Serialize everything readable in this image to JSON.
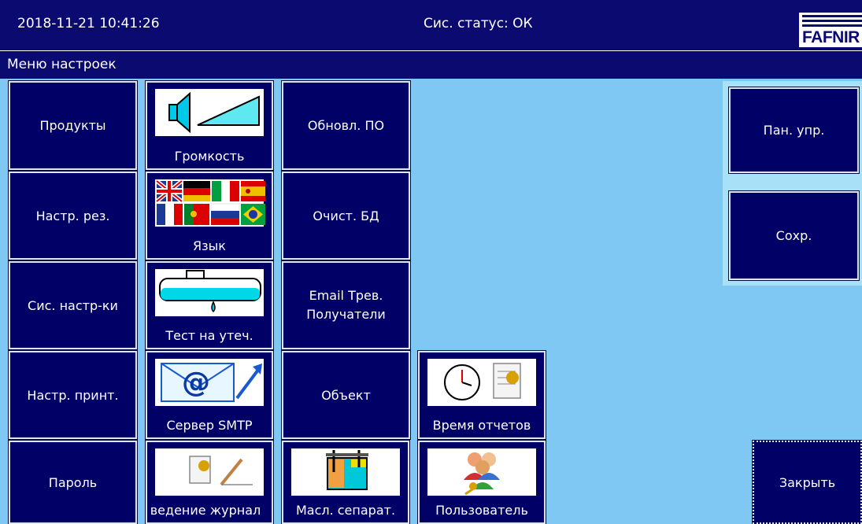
{
  "header": {
    "datetime": "2018-11-21  10:41:26",
    "status": "Сис. статус: ОК",
    "logo_text": "FAFNIR"
  },
  "menu_title": "Меню настроек",
  "buttons": {
    "products": "Продукты",
    "volume": "Громкость",
    "software_update": "Обновл. ПО",
    "tank_settings": "Настр. рез.",
    "language": "Язык",
    "clear_db": "Очист. БД",
    "system_settings": "Сис. настр-ки",
    "leak_test": "Тест на утеч.",
    "email_alarm_line1": "Email Трев.",
    "email_alarm_line2": "Получатели",
    "printer_settings": "Настр. принт.",
    "smtp_server": "Сервер SMTP",
    "site": "Объект",
    "report_time": "Время отчетов",
    "password": "Пароль",
    "logging": "ведение журнал",
    "oil_separator": "Масл. сепарат.",
    "user": "Пользователь",
    "control_panel": "Пан. упр.",
    "save": "Сохр.",
    "close": "Закрыть"
  },
  "colors": {
    "background": "#80c8f4",
    "bar": "#0a0a70",
    "button": "#000066",
    "right_panel": "#a8e0f8"
  }
}
